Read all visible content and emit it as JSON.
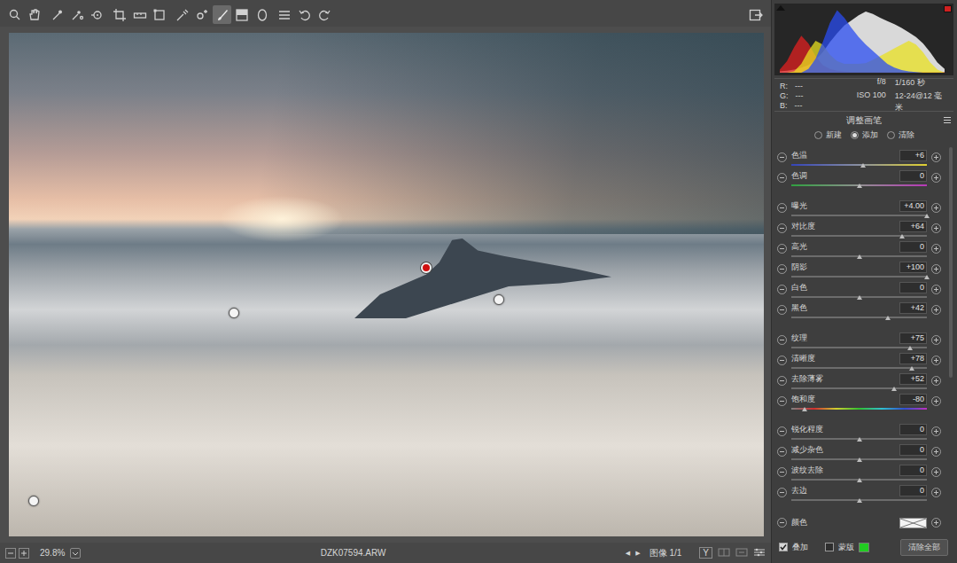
{
  "toolbar": {
    "tools": [
      {
        "selected": false
      },
      {
        "selected": false
      },
      {
        "selected": false
      },
      {
        "selected": false
      },
      {
        "selected": false
      },
      {
        "selected": false
      },
      {
        "selected": false
      },
      {
        "selected": false
      },
      {
        "selected": false
      },
      {
        "selected": false
      },
      {
        "selected": true
      },
      {
        "selected": false
      },
      {
        "selected": false
      },
      {
        "selected": false
      },
      {
        "selected": false
      },
      {
        "selected": false
      }
    ]
  },
  "photo": {
    "pins": [
      {
        "selected": true
      },
      {
        "selected": false
      },
      {
        "selected": false
      },
      {
        "selected": false
      }
    ]
  },
  "status_bar": {
    "zoom": "29.8%",
    "filename": "DZK07594.ARW",
    "prev": "◀",
    "next": "▶",
    "image_nav": "图像 1/1",
    "y_button": "Y"
  },
  "histogram": {
    "series": [
      {
        "color": "#d9d9d9",
        "values": [
          2,
          3,
          5,
          8,
          12,
          20,
          32,
          48,
          62,
          74,
          82,
          90,
          96,
          92,
          86,
          81,
          76,
          70,
          63,
          56,
          46,
          32,
          16,
          6
        ]
      },
      {
        "color": "#e02020",
        "values": [
          5,
          18,
          40,
          58,
          46,
          26,
          12,
          6,
          3,
          2,
          1,
          1,
          1,
          1,
          1,
          1,
          1,
          1,
          1,
          1,
          1,
          1,
          1,
          1
        ]
      },
      {
        "color": "#e8e020",
        "values": [
          0,
          0,
          2,
          14,
          34,
          50,
          44,
          28,
          18,
          14,
          14,
          14,
          15,
          20,
          26,
          32,
          38,
          44,
          50,
          44,
          32,
          16,
          5,
          0
        ]
      },
      {
        "color": "#2a4cf0",
        "values": [
          0,
          0,
          0,
          0,
          6,
          22,
          48,
          78,
          98,
          86,
          70,
          56,
          44,
          34,
          24,
          14,
          8,
          4,
          2,
          1,
          0,
          0,
          0,
          0
        ]
      }
    ]
  },
  "info": {
    "rgb": [
      {
        "label": "R:",
        "value": "---"
      },
      {
        "label": "G:",
        "value": "---"
      },
      {
        "label": "B:",
        "value": "---"
      }
    ],
    "aperture": "f/8",
    "shutter": "1/160 秒",
    "iso": "ISO 100",
    "lens": "12-24@12 毫米"
  },
  "panel": {
    "title": "调整画笔",
    "modes": [
      {
        "label": "新建",
        "selected": false
      },
      {
        "label": "添加",
        "selected": true
      },
      {
        "label": "清除",
        "selected": false
      }
    ],
    "slider_groups": [
      [
        {
          "label": "色温",
          "value": "+6",
          "level": 0.53,
          "kind": "temp"
        },
        {
          "label": "色调",
          "value": "0",
          "level": 0.5,
          "kind": "tint"
        }
      ],
      [
        {
          "label": "曝光",
          "value": "+4.00",
          "level": 1,
          "kind": "plain"
        },
        {
          "label": "对比度",
          "value": "+64",
          "level": 0.82,
          "kind": "plain"
        },
        {
          "label": "高光",
          "value": "0",
          "level": 0.5,
          "kind": "plain"
        },
        {
          "label": "阴影",
          "value": "+100",
          "level": 1,
          "kind": "plain"
        },
        {
          "label": "白色",
          "value": "0",
          "level": 0.5,
          "kind": "plain"
        },
        {
          "label": "黑色",
          "value": "+42",
          "level": 0.71,
          "kind": "plain"
        }
      ],
      [
        {
          "label": "纹理",
          "value": "+75",
          "level": 0.875,
          "kind": "plain"
        },
        {
          "label": "清晰度",
          "value": "+78",
          "level": 0.89,
          "kind": "plain"
        },
        {
          "label": "去除薄雾",
          "value": "+52",
          "level": 0.76,
          "kind": "plain"
        },
        {
          "label": "饱和度",
          "value": "-80",
          "level": 0.1,
          "kind": "saturation"
        }
      ],
      [
        {
          "label": "锐化程度",
          "value": "0",
          "level": 0.5,
          "kind": "plain"
        },
        {
          "label": "减少杂色",
          "value": "0",
          "level": 0.5,
          "kind": "plain"
        },
        {
          "label": "波纹去除",
          "value": "0",
          "level": 0.5,
          "kind": "plain"
        },
        {
          "label": "去边",
          "value": "0",
          "level": 0.5,
          "kind": "plain"
        }
      ]
    ],
    "color": {
      "label": "颜色"
    },
    "overlay": {
      "label": "叠加",
      "checked": true
    },
    "mask": {
      "label": "蒙版",
      "checked": false,
      "color": "#22cc22"
    },
    "clear_all": "清除全部"
  }
}
